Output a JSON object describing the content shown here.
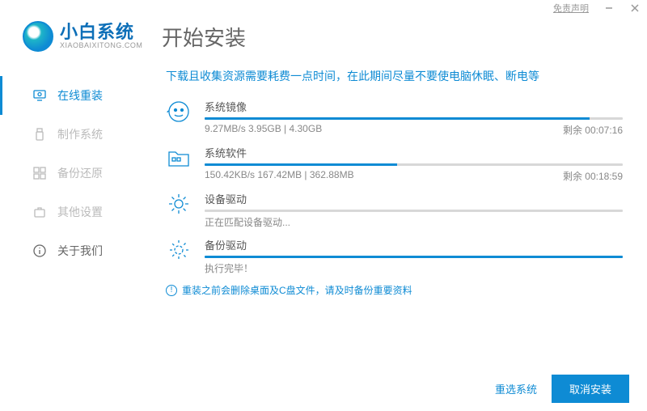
{
  "titlebar": {
    "disclaimer": "免责声明"
  },
  "brand": {
    "name_cn": "小白系统",
    "name_en": "XIAOBAIXITONG.COM"
  },
  "page_title": "开始安装",
  "sidebar": {
    "items": [
      {
        "label": "在线重装",
        "active": true
      },
      {
        "label": "制作系统",
        "active": false
      },
      {
        "label": "备份还原",
        "active": false
      },
      {
        "label": "其他设置",
        "active": false
      },
      {
        "label": "关于我们",
        "active": false
      }
    ]
  },
  "main": {
    "notice": "下载且收集资源需要耗费一点时间，在此期间尽量不要使电脑休眠、断电等",
    "tasks": [
      {
        "title": "系统镜像",
        "detail": "9.27MB/s 3.95GB | 4.30GB",
        "remain": "剩余 00:07:16",
        "progress": 92
      },
      {
        "title": "系统软件",
        "detail": "150.42KB/s 167.42MB | 362.88MB",
        "remain": "剩余 00:18:59",
        "progress": 46
      },
      {
        "title": "设备驱动",
        "detail": "正在匹配设备驱动...",
        "remain": "",
        "progress": 0
      },
      {
        "title": "备份驱动",
        "detail": "执行完毕！",
        "remain": "",
        "progress": 100
      }
    ],
    "warning": "重装之前会删除桌面及C盘文件，请及时备份重要资料"
  },
  "footer": {
    "reselect": "重选系统",
    "cancel": "取消安装"
  }
}
